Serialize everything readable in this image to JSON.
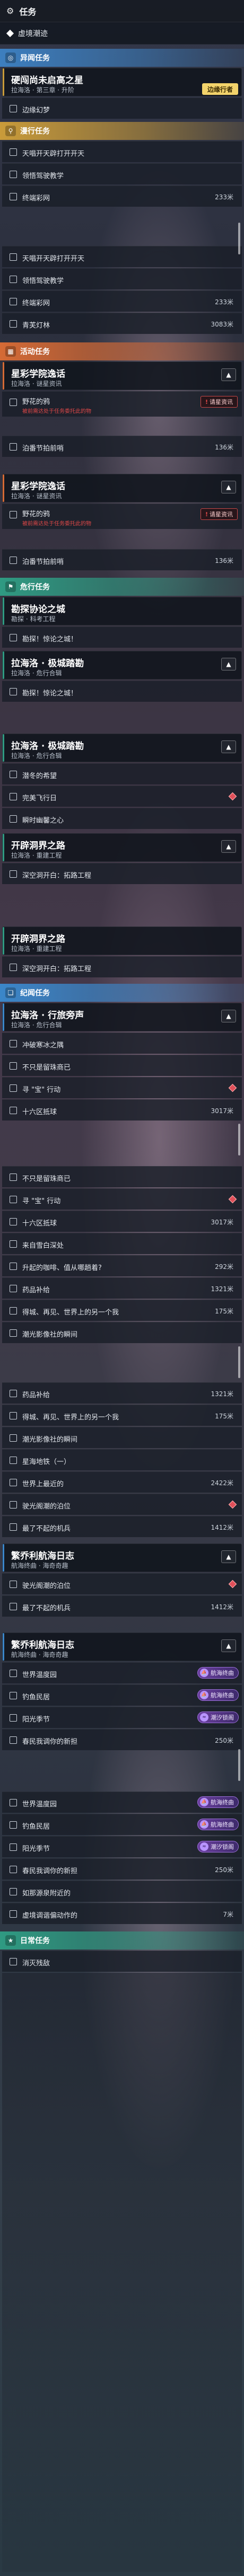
{
  "header": {
    "title": "任务",
    "icon": "gear-icon"
  },
  "sub_header": {
    "label": "虚境潮迹",
    "icon": "diamond-icon"
  },
  "colors": {
    "blue": "#3d7fbf",
    "gold": "#c99b3a",
    "orange": "#d56a35",
    "teal": "#2f9a82",
    "warning": "#e04848",
    "tag_gold": "#f3d36b"
  },
  "sections": [
    {
      "name": "异闻任务",
      "icon": "target-icon",
      "color": "blue"
    },
    {
      "name": "漫行任务",
      "icon": "pin-icon",
      "color": "gold"
    },
    {
      "name": "活动任务",
      "icon": "calendar-icon",
      "color": "orange"
    },
    {
      "name": "危行任务",
      "icon": "flag-icon",
      "color": "teal"
    },
    {
      "name": "纪闻任务",
      "icon": "book-icon",
      "color": "sky"
    },
    {
      "name": "日常任务",
      "icon": "star-icon",
      "color": "teal"
    }
  ],
  "texts": {
    "c_yihan_title": "硬闯尚未启高之星",
    "c_yihan_sub": "拉海洛 · 第三章 · 升阶",
    "c_yihan_tag": "边缘行者",
    "r_yihan_1": "边缘幻梦",
    "r_man_1": "天唱开天辟打开开天",
    "r_man_2": "领悟驾驶教学",
    "r_man_3": "终端彩网",
    "r_man_3d": "233米",
    "r_man_4": "天唱开天辟打开开天",
    "r_man_5": "领悟驾驶教学",
    "r_man_6": "终端彩网",
    "r_man_6d": "233米",
    "r_man_7": "青芙灯林",
    "r_man_7d": "3083米",
    "c_act_title": "星彩学院逸话",
    "c_act_sub": "拉海洛 · 谜星资讯",
    "r_act_1": "野花的鸦",
    "r_act_1s": "被前需达处于任务委托此的物",
    "r_act_1w": "请星资讯",
    "r_act_2": "泊番节拍前哨",
    "r_act_2d": "136米",
    "c_act2_title": "星彩学院逸话",
    "c_act2_sub": "拉海洛 · 谜星资讯",
    "r_act2_1": "野花的鸦",
    "r_act2_1s": "被前需达处于任务委托此的物",
    "r_act2_1w": "请星资讯",
    "r_act2_2": "泊番节拍前哨",
    "r_act2_2d": "136米",
    "c_dan_title": "勘探协论之城",
    "c_dan_sub": "勘探 · 科考工程",
    "r_dan_1": "勘探！惊论之城！",
    "c_dan2_title": "拉海洛 · 极城踏勘",
    "c_dan2_sub": "拉海洛 · 危行合辑",
    "r_dan2_1": "勘探！惊论之城！",
    "c_dan3_title": "拉海洛 · 极城踏勘",
    "c_dan3_sub": "拉海洛 · 危行合辑",
    "r_dan3_1": "潜冬的希望",
    "r_dan3_2": "完美飞行日",
    "r_dan3_3": "瞬时幽馨之心",
    "c_dan4_title": "开辟洞界之路",
    "c_dan4_sub": "拉海洛 · 重建工程",
    "r_dan4_1": "深空洞开白：拓路工程",
    "c_dan5_title": "开辟洞界之路",
    "c_dan5_sub": "拉海洛 · 重建工程",
    "r_dan5_1": "深空洞开白：拓路工程",
    "c_ji_title": "拉海洛 · 行旅旁声",
    "c_ji_sub": "拉海洛 · 危行合辑",
    "r_ji_1": "冲破寒冰之隅",
    "r_ji_2": "不只是留珠商已",
    "r_ji_3": "寻 \"宝\" 行动",
    "r_ji_4": "十六区抵球",
    "r_ji_4d": "3017米",
    "r_ji_5": "不只是留珠商已",
    "r_ji_6": "寻 \"宝\" 行动",
    "r_ji_7": "十六区抵球",
    "r_ji_7d": "3017米",
    "r_ji_8": "来自雪白深处",
    "r_ji_9": "升起的咖啡、值从哪趟着?",
    "r_ji_9d": "292米",
    "r_ji_10": "药品补给",
    "r_ji_10d": "1321米",
    "r_ji_11": "得城、再见、世界上的另一个我",
    "r_ji_11d": "175米",
    "r_ji_12": "潮光影像社的瞬间",
    "r_ji_13": "药品补给",
    "r_ji_13d": "1321米",
    "r_ji_14": "得城、再见、世界上的另一个我",
    "r_ji_14d": "175米",
    "r_ji_15": "潮光影像社的瞬间",
    "r_ji_16": "星海地铁（一）",
    "r_ji_17": "世界上最近的",
    "r_ji_17d": "2422米",
    "r_ji_18": "驶光阁潮的泊位",
    "r_ji_19": "最了不起的机兵",
    "r_ji_19d": "1412米",
    "c_ji2_title": "繁乔利航海日志",
    "c_ji2_sub": "航海终曲 · 海奇奇趣",
    "r_ji2_1": "驶光阁潮的泊位",
    "r_ji2_2": "最了不起的机兵",
    "r_ji2_2d": "1412米",
    "c_ji3_title": "繁乔利航海日志",
    "c_ji3_sub": "航海终曲 · 海奇奇趣",
    "r_ji3_1": "世界温度园",
    "r_ji3_1t": "航海终曲",
    "r_ji3_2": "钓鱼民居",
    "r_ji3_2t": "航海终曲",
    "r_ji3_3": "阳光季节",
    "r_ji3_3t": "潮汐锁阁",
    "r_ji3_4": "春民我调你的新担",
    "r_ji3_4d": "250米",
    "r_ji3_5": "世界温度园",
    "r_ji3_5t": "航海终曲",
    "r_ji3_6": "钓鱼民居",
    "r_ji3_6t": "航海终曲",
    "r_ji3_7": "阳光季节",
    "r_ji3_7t": "潮汐锁阁",
    "r_ji3_8": "春民我调你的新担",
    "r_ji3_8d": "250米",
    "r_ji3_9": "如那源泉附近的",
    "r_ji3_10": "虚境调谐偏动作的",
    "r_ji3_10d": "7米",
    "r_day_1": "消灭残敌"
  }
}
